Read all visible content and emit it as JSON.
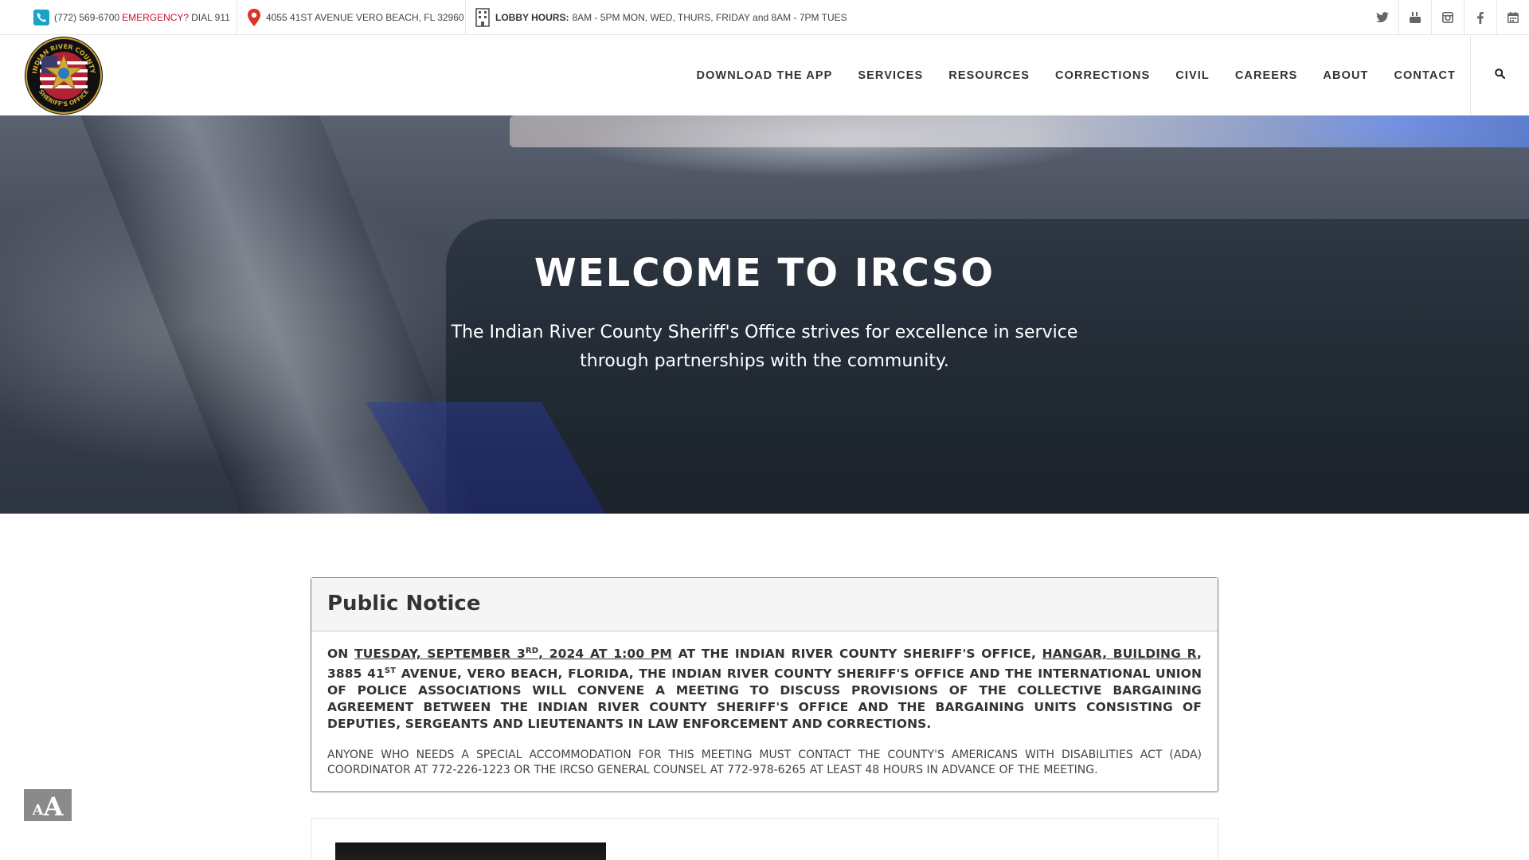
{
  "topbar": {
    "phone": "(772) 569-6700",
    "emergency_label": "EMERGENCY?",
    "dial": "DIAL 911",
    "address": "4055 41ST AVENUE VERO BEACH, FL 32960",
    "hours_label": "LOBBY HOURS:",
    "hours_text": "8AM - 5PM MON, WED, THURS, FRIDAY and 8AM - 7PM TUES",
    "social": [
      "twitter-icon",
      "youtube-icon",
      "instagram-icon",
      "facebook-icon",
      "calendar-icon"
    ]
  },
  "header": {
    "logo_text_top": "INDIAN RIVER COUNTY",
    "logo_text_bottom": "SHERIFF'S OFFICE",
    "nav": [
      {
        "label": "DOWNLOAD THE APP"
      },
      {
        "label": "SERVICES"
      },
      {
        "label": "RESOURCES"
      },
      {
        "label": "CORRECTIONS"
      },
      {
        "label": "CIVIL"
      },
      {
        "label": "CAREERS"
      },
      {
        "label": "ABOUT"
      },
      {
        "label": "CONTACT"
      }
    ]
  },
  "hero": {
    "title": "WELCOME TO IRCSO",
    "subtitle": "The Indian River County Sheriff's Office strives for excellence in service through partnerships with the community."
  },
  "notice": {
    "title": "Public Notice",
    "p1_on": "ON",
    "p1_date": "TUESDAY, SEPTEMBER 3",
    "p1_date_sup": "RD",
    "p1_time": ", 2024 AT 1:00 PM",
    "p1_at": "AT THE INDIAN RIVER COUNTY SHERIFF'S OFFICE,",
    "p1_hangar": "HANGAR, BUILDING R",
    "p1_addr": ", 3885 41",
    "p1_addr_sup": "st",
    "p1_rest": "AVENUE, VERO BEACH, FLORIDA, THE INDIAN RIVER COUNTY SHERIFF'S OFFICE AND THE INTERNATIONAL UNION OF POLICE ASSOCIATIONS WILL CONVENE A MEETING TO DISCUSS PROVISIONS OF THE COLLECTIVE BARGAINING AGREEMENT BETWEEN THE INDIAN RIVER COUNTY SHERIFF'S OFFICE AND THE BARGAINING UNITS CONSISTING OF DEPUTIES, SERGEANTS AND LIEUTENANTS IN LAW ENFORCEMENT AND CORRECTIONS.",
    "p2": "ANYONE WHO NEEDS A SPECIAL ACCOMMODATION FOR THIS MEETING MUST CONTACT THE COUNTY'S AMERICANS WITH DISABILITIES ACT (ADA) COORDINATOR AT 772-226-1223 OR THE IRCSO GENERAL COUNSEL AT 772-978-6265 AT LEAST 48 HOURS IN ADVANCE OF THE MEETING."
  },
  "accessibility": {
    "small": "A",
    "big": "A"
  },
  "colors": {
    "emergency": "#c8102e",
    "pin": "#d9342b",
    "phone_icon": "#1aa3c8",
    "text": "#333333"
  }
}
